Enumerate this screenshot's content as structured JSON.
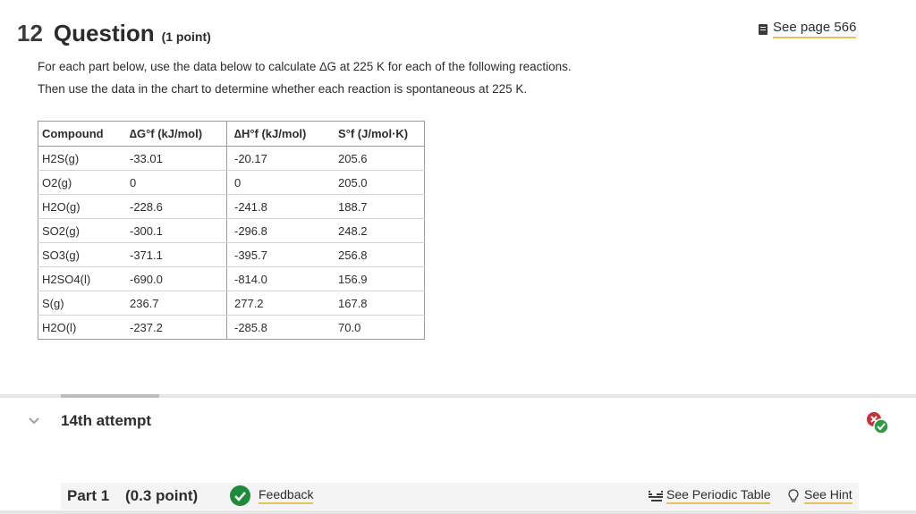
{
  "question": {
    "number": "12",
    "title": "Question",
    "points": "(1 point)",
    "see_page": "See page 566",
    "prompt_line1": "For each part below, use the data below to calculate ∆G at 225 K for each of the following reactions.",
    "prompt_line2": "Then use the data in the chart to determine whether each reaction is spontaneous at 225 K."
  },
  "table": {
    "headers": [
      "Compound",
      "∆G°f (kJ/mol)",
      "∆H°f (kJ/mol)",
      "S°f (J/mol·K)"
    ],
    "rows": [
      [
        "H2S(g)",
        "-33.01",
        "-20.17",
        "205.6"
      ],
      [
        "O2(g)",
        "0",
        "0",
        "205.0"
      ],
      [
        "H2O(g)",
        "-228.6",
        "-241.8",
        "188.7"
      ],
      [
        "SO2(g)",
        "-300.1",
        "-296.8",
        "248.2"
      ],
      [
        "SO3(g)",
        "-371.1",
        "-395.7",
        "256.8"
      ],
      [
        "H2SO4(l)",
        "-690.0",
        "-814.0",
        "156.9"
      ],
      [
        "S(g)",
        "236.7",
        "277.2",
        "167.8"
      ],
      [
        "H2O(l)",
        "-237.2",
        "-285.8",
        "70.0"
      ]
    ]
  },
  "attempt": {
    "label": "14th attempt"
  },
  "part": {
    "label": "Part 1",
    "points": "(0.3 point)",
    "feedback": "Feedback",
    "periodic_table": "See Periodic Table",
    "hint": "See Hint"
  },
  "colors": {
    "accent_underline": "#e8c15a",
    "success": "#1f8a3a",
    "error": "#c8303a"
  }
}
